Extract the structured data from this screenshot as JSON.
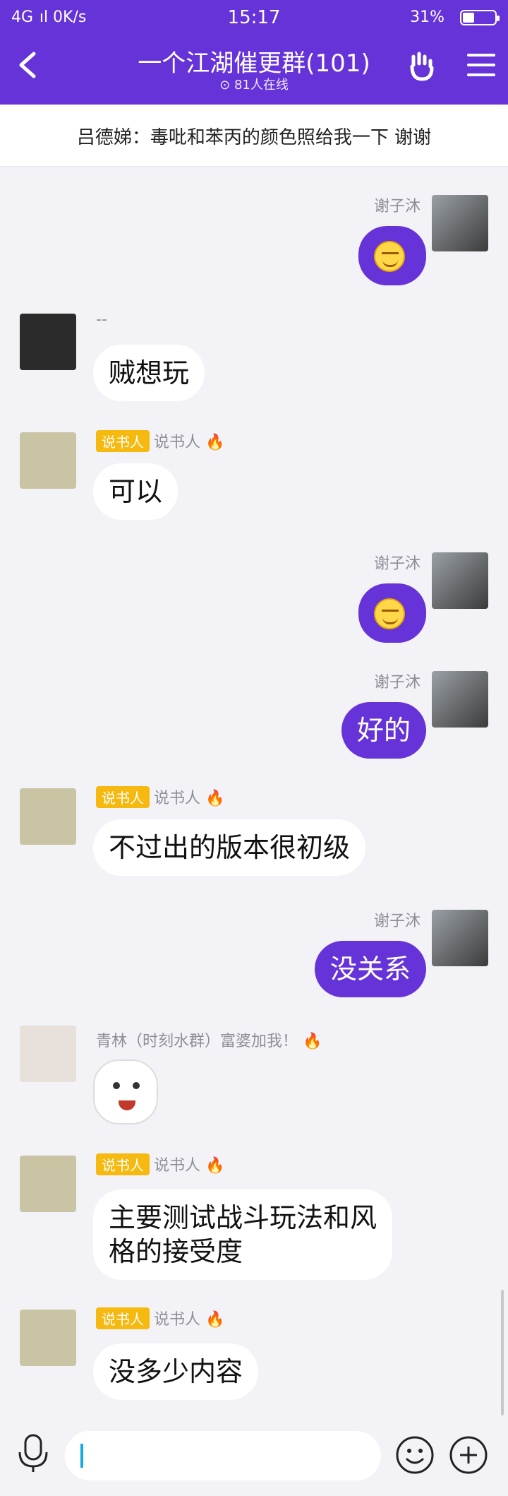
{
  "status_bar": {
    "left": "4G  ıl 0K/s",
    "time": "15:17",
    "battery": "31%"
  },
  "header": {
    "back_label": "back",
    "title": "一个江湖催更群(101)",
    "online": "81人在线"
  },
  "notice": {
    "text": "吕德娣：毒吡和苯丙的颜色照给我一下  谢谢"
  },
  "messages": [
    {
      "name": "谢子沐"
    },
    {
      "name": "--",
      "text": "贼想玩"
    },
    {
      "badge": "说书人",
      "name": "说书人",
      "text": "可以"
    },
    {
      "name": "谢子沐"
    },
    {
      "name": "谢子沐",
      "text": "好的"
    },
    {
      "badge": "说书人",
      "name": "说书人",
      "text": "不过出的版本很初级"
    },
    {
      "name": "谢子沐",
      "text": "没关系"
    },
    {
      "name": "青林（时刻水群）富婆加我！"
    },
    {
      "badge": "说书人",
      "name": "说书人",
      "text_line1": "主要测试战斗玩法和风",
      "text_line2": "格的接受度"
    },
    {
      "badge": "说书人",
      "name": "说书人",
      "text": "没多少内容"
    }
  ],
  "input": {
    "placeholder": ""
  },
  "icons": {
    "fire": "🔥"
  },
  "colors": {
    "brand": "#6633d9",
    "badge": "#f5b90f"
  }
}
